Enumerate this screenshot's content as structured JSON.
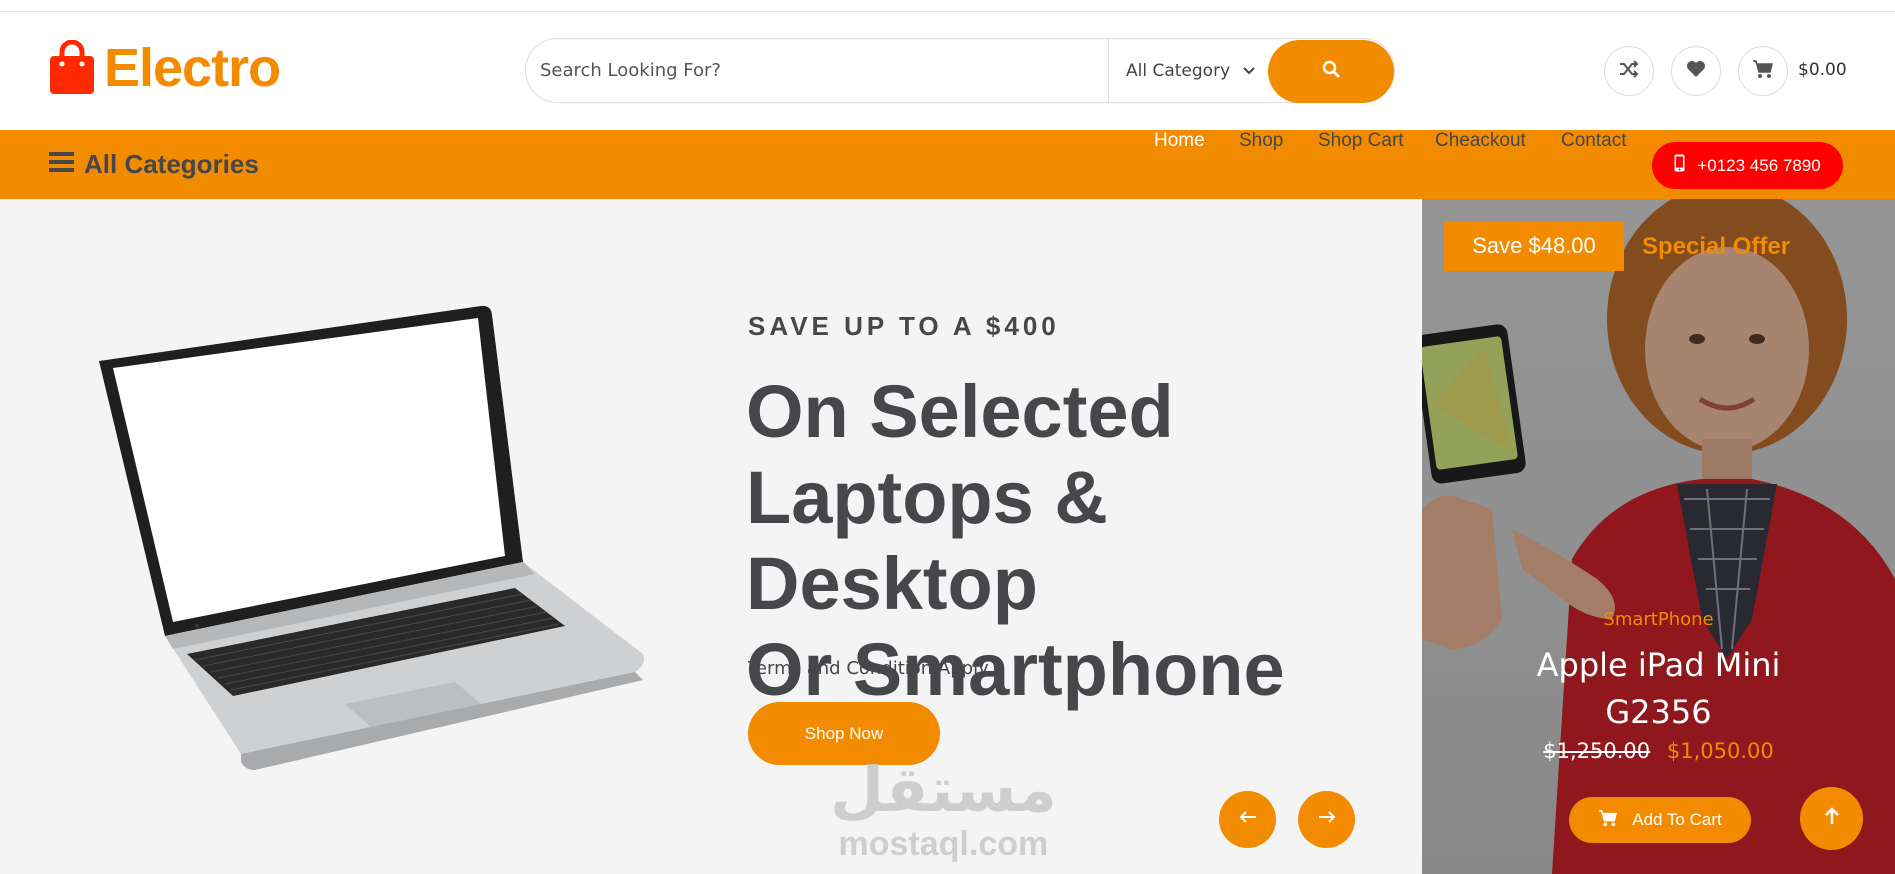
{
  "brand": {
    "name": "Electro",
    "color": "#f28b00"
  },
  "search": {
    "placeholder": "Search Looking For?",
    "category": "All Category"
  },
  "header_icons": [
    "shuffle-icon",
    "heart-icon",
    "cart-icon"
  ],
  "cart": {
    "total": "$0.00"
  },
  "nav": {
    "all_categories": "All Categories",
    "links": [
      "Home",
      "Shop",
      "Shop Cart",
      "Cheackout",
      "Contact"
    ],
    "active": "Home",
    "phone": "+0123 456 7890"
  },
  "hero": {
    "kicker": "SAVE UP TO A $400",
    "headline_lines": [
      "On Selected",
      "Laptops & Desktop",
      "Or Smartphone"
    ],
    "terms": "Terms and Condition Apply",
    "cta": "Shop Now"
  },
  "promo": {
    "save_badge": "Save $48.00",
    "special": "Special Offer",
    "category": "SmartPhone",
    "title_lines": [
      "Apple iPad Mini",
      "G2356"
    ],
    "old_price": "$1,250.00",
    "new_price": "$1,050.00",
    "add_to_cart": "Add To Cart"
  },
  "watermark": {
    "arabic": "مستقل",
    "latin": "mostaql.com"
  },
  "colors": {
    "accent": "#f28b00",
    "phone_button": "#ff0000",
    "text": "#45474a",
    "hero_bg": "#f4f4f4"
  }
}
